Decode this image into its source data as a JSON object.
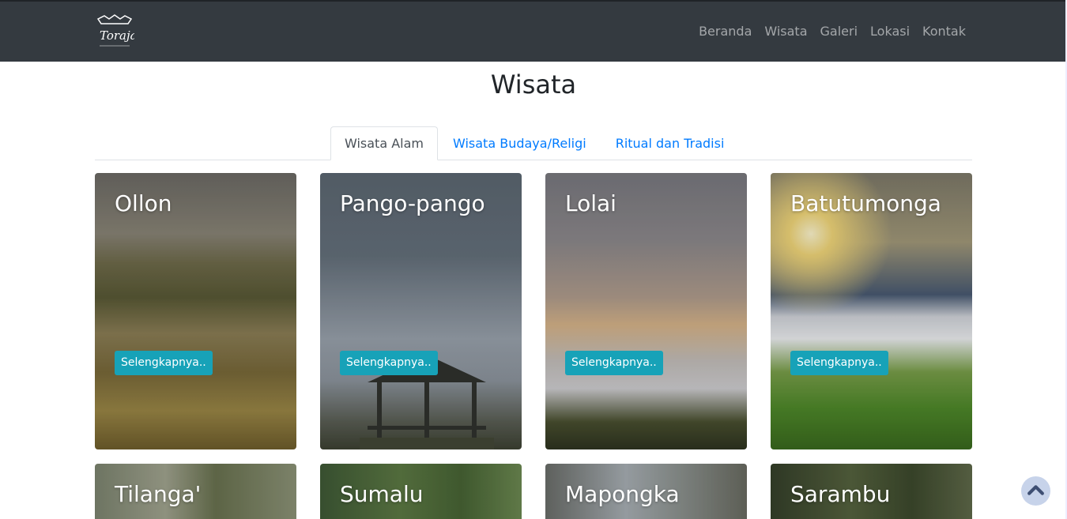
{
  "nav": {
    "logo_text": "Toraja",
    "links": [
      "Beranda",
      "Wisata",
      "Galeri",
      "Lokasi",
      "Kontak"
    ]
  },
  "page": {
    "title": "Wisata"
  },
  "tabs": [
    {
      "label": "Wisata Alam",
      "active": true
    },
    {
      "label": "Wisata Budaya/Religi",
      "active": false
    },
    {
      "label": "Ritual dan Tradisi",
      "active": false
    }
  ],
  "cards": [
    {
      "title": "Ollon",
      "button": "Selengkapnya.."
    },
    {
      "title": "Pango-pango",
      "button": "Selengkapnya.."
    },
    {
      "title": "Lolai",
      "button": "Selengkapnya.."
    },
    {
      "title": "Batutumonga",
      "button": "Selengkapnya.."
    },
    {
      "title": "Tilanga'"
    },
    {
      "title": "Sumalu"
    },
    {
      "title": "Mapongka"
    },
    {
      "title": "Sarambu"
    }
  ],
  "icons": {
    "scroll_top": "chevron-up-icon"
  },
  "colors": {
    "navbar": "#343a40",
    "accent": "#17a2b8",
    "link": "#007bff"
  }
}
